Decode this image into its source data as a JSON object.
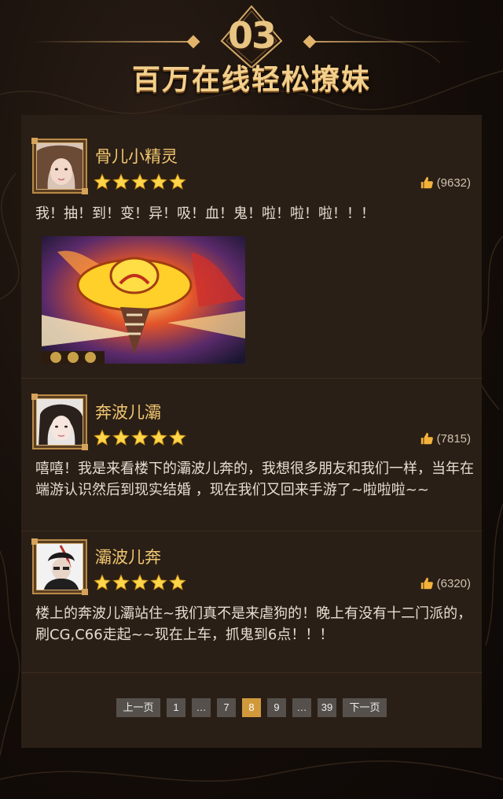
{
  "header": {
    "number": "03",
    "title": "百万在线轻松撩妹"
  },
  "comments": [
    {
      "username": "骨儿小精灵",
      "rating": 5,
      "likes": "(9632)",
      "text": "我！抽！到！变！异！吸！血！鬼！啦！啦！啦！！！",
      "has_image": true
    },
    {
      "username": "奔波儿灞",
      "rating": 5,
      "likes": "(7815)",
      "text": "嘻嘻！我是来看楼下的灞波儿奔的，我想很多朋友和我们一样，当年在端游认识然后到现实结婚 ，现在我们又回来手游了~啦啦啦~~"
    },
    {
      "username": "灞波儿奔",
      "rating": 5,
      "likes": "(6320)",
      "text": "楼上的奔波儿灞站住~我们真不是来虐狗的！晚上有没有十二门派的，刷CG,C66走起~~现在上车，抓鬼到6点！！！"
    }
  ],
  "pagination": {
    "prev": "上一页",
    "next": "下一页",
    "pages": [
      "1",
      "…",
      "7",
      "8",
      "9",
      "…",
      "39"
    ],
    "current": "8"
  },
  "colors": {
    "accent_gold": "#f0c670",
    "panel_bg": "#2a1f16",
    "active_page": "#d09a3c"
  },
  "icons": {
    "star": "star-icon",
    "like": "thumbs-up-icon"
  }
}
